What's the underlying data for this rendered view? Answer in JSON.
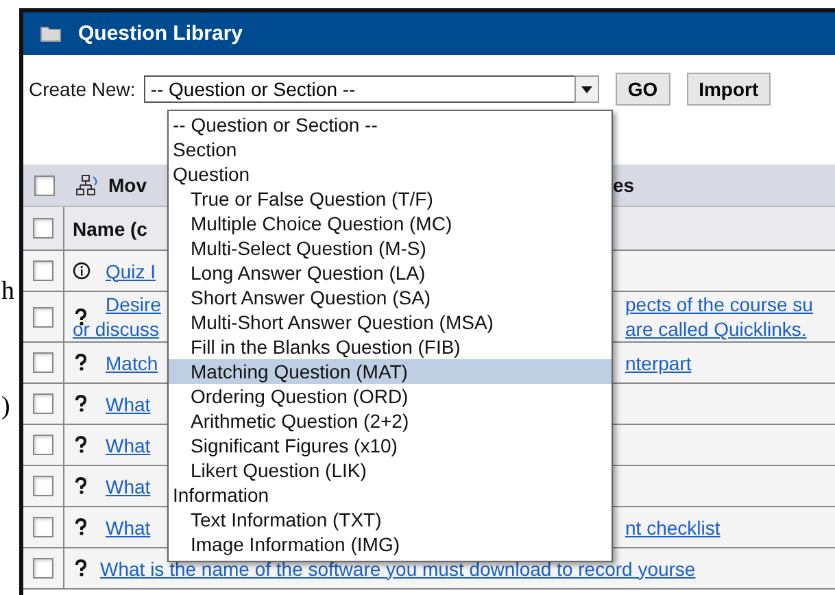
{
  "margin_text": [
    "h",
    ")"
  ],
  "header": {
    "title": "Question Library"
  },
  "create_new": {
    "label": "Create New:",
    "value": "-- Question or Section --",
    "buttons": [
      "GO",
      "Import"
    ]
  },
  "dropdown": [
    {
      "label": "-- Question or Section --",
      "selected": false
    },
    {
      "label": "Section",
      "selected": false
    },
    {
      "label": "Question",
      "selected": false,
      "children": [
        {
          "label": "True or False Question (T/F)",
          "selected": false
        },
        {
          "label": "Multiple Choice Question (MC)",
          "selected": false
        },
        {
          "label": "Multi-Select Question (M-S)",
          "selected": false
        },
        {
          "label": "Long Answer Question (LA)",
          "selected": false
        },
        {
          "label": "Short Answer Question (SA)",
          "selected": false
        },
        {
          "label": "Multi-Short Answer Question (MSA)",
          "selected": false
        },
        {
          "label": "Fill in the Blanks Question (FIB)",
          "selected": false
        },
        {
          "label": "Matching Question (MAT)",
          "selected": true
        },
        {
          "label": "Ordering Question (ORD)",
          "selected": false
        },
        {
          "label": "Arithmetic Question (2+2)",
          "selected": false
        },
        {
          "label": "Significant Figures (x10)",
          "selected": false
        },
        {
          "label": "Likert Question (LIK)",
          "selected": false
        }
      ]
    },
    {
      "label": "Information",
      "selected": false,
      "children": [
        {
          "label": "Text Information (TXT)",
          "selected": false
        },
        {
          "label": "Image Information (IMG)",
          "selected": false
        }
      ]
    }
  ],
  "toolbar": {
    "checked": false,
    "action": "Mov",
    "right": "es"
  },
  "table": {
    "header_checked": false,
    "column_header": "Name (c",
    "rows": [
      {
        "kind": "info",
        "checked": false,
        "left": [
          "Quiz I"
        ],
        "right": []
      },
      {
        "kind": "question",
        "checked": false,
        "left": [
          "Desire",
          "or discuss"
        ],
        "right": [
          "pects of the course su",
          "are called Quicklinks."
        ]
      },
      {
        "kind": "question",
        "checked": false,
        "left": [
          "Match"
        ],
        "right": [
          "nterpart"
        ]
      },
      {
        "kind": "question",
        "checked": false,
        "left": [
          "What"
        ],
        "right": []
      },
      {
        "kind": "question",
        "checked": false,
        "left": [
          "What"
        ],
        "right": []
      },
      {
        "kind": "question",
        "checked": false,
        "left": [
          "What"
        ],
        "right": []
      },
      {
        "kind": "question",
        "checked": false,
        "left": [
          "What"
        ],
        "right": [
          "nt checklist"
        ]
      },
      {
        "kind": "question",
        "checked": false,
        "full": "What is the name of the software you must download to record yourse"
      }
    ]
  }
}
